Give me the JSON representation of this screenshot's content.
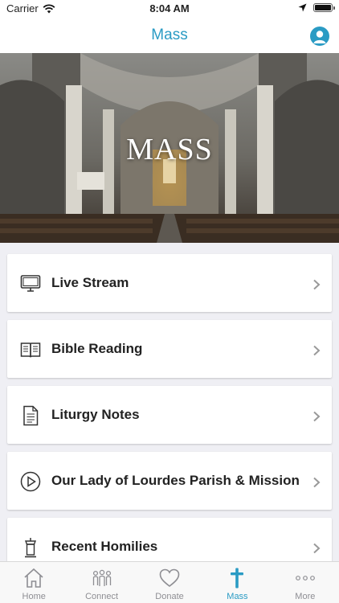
{
  "status_bar": {
    "carrier": "Carrier",
    "time": "8:04 AM"
  },
  "nav": {
    "title": "Mass"
  },
  "hero": {
    "title": "MASS"
  },
  "menu": {
    "items": [
      {
        "label": "Live Stream",
        "icon": "monitor-icon"
      },
      {
        "label": "Bible Reading",
        "icon": "book-icon"
      },
      {
        "label": "Liturgy Notes",
        "icon": "document-icon"
      },
      {
        "label": "Our Lady of Lourdes Parish & Mission",
        "icon": "play-circle-icon"
      },
      {
        "label": "Recent Homilies",
        "icon": "pulpit-icon"
      }
    ]
  },
  "tabs": [
    {
      "label": "Home",
      "icon": "house-icon",
      "active": false
    },
    {
      "label": "Connect",
      "icon": "people-icon",
      "active": false
    },
    {
      "label": "Donate",
      "icon": "heart-icon",
      "active": false
    },
    {
      "label": "Mass",
      "icon": "cross-icon",
      "active": true
    },
    {
      "label": "More",
      "icon": "ellipsis-icon",
      "active": false
    }
  ],
  "colors": {
    "accent": "#2a9bc4",
    "inactive": "#8e8e93",
    "background": "#efeff4"
  }
}
